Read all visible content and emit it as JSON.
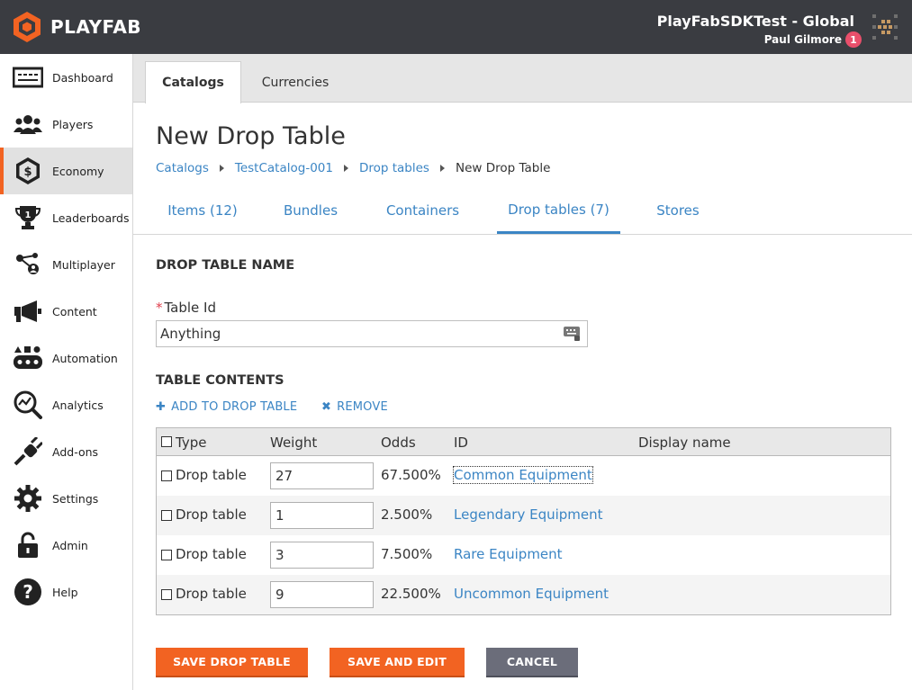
{
  "app": {
    "brand": "PLAYFAB",
    "title": "PlayFabSDKTest - Global",
    "user": "Paul Gilmore",
    "notification_count": "1"
  },
  "sidebar": {
    "items": [
      {
        "label": "Dashboard",
        "icon": "dashboard-icon"
      },
      {
        "label": "Players",
        "icon": "players-icon"
      },
      {
        "label": "Economy",
        "icon": "economy-icon",
        "active": true
      },
      {
        "label": "Leaderboards",
        "icon": "leaderboards-icon"
      },
      {
        "label": "Multiplayer",
        "icon": "multiplayer-icon"
      },
      {
        "label": "Content",
        "icon": "megaphone-icon"
      },
      {
        "label": "Automation",
        "icon": "automation-icon"
      },
      {
        "label": "Analytics",
        "icon": "analytics-icon"
      },
      {
        "label": "Add-ons",
        "icon": "plug-icon"
      },
      {
        "label": "Settings",
        "icon": "gear-icon"
      },
      {
        "label": "Admin",
        "icon": "lock-icon"
      },
      {
        "label": "Help",
        "icon": "help-icon"
      }
    ]
  },
  "main_tabs": [
    {
      "label": "Catalogs",
      "active": true
    },
    {
      "label": "Currencies",
      "active": false
    }
  ],
  "page": {
    "title": "New Drop Table",
    "breadcrumb": [
      "Catalogs",
      "TestCatalog-001",
      "Drop tables",
      "New Drop Table"
    ]
  },
  "sub_tabs": [
    {
      "label": "Items (12)"
    },
    {
      "label": "Bundles"
    },
    {
      "label": "Containers"
    },
    {
      "label": "Drop tables (7)",
      "active": true
    },
    {
      "label": "Stores"
    }
  ],
  "form": {
    "name_section": "DROP TABLE NAME",
    "table_id_required": "*",
    "table_id_label": "Table Id",
    "table_id_value": "Anything",
    "contents_section": "TABLE CONTENTS",
    "add_label": "ADD TO DROP TABLE",
    "remove_label": "REMOVE"
  },
  "table": {
    "columns": [
      "Type",
      "Weight",
      "Odds",
      "ID",
      "Display name"
    ],
    "rows": [
      {
        "type": "Drop table",
        "weight": "27",
        "odds": "67.500%",
        "id": "Common Equipment",
        "display_name": ""
      },
      {
        "type": "Drop table",
        "weight": "1",
        "odds": "2.500%",
        "id": "Legendary Equipment",
        "display_name": ""
      },
      {
        "type": "Drop table",
        "weight": "3",
        "odds": "7.500%",
        "id": "Rare Equipment",
        "display_name": ""
      },
      {
        "type": "Drop table",
        "weight": "9",
        "odds": "22.500%",
        "id": "Uncommon Equipment",
        "display_name": ""
      }
    ]
  },
  "buttons": {
    "save": "SAVE DROP TABLE",
    "save_edit": "SAVE AND EDIT",
    "cancel": "CANCEL"
  },
  "colors": {
    "accent_orange": "#f26322",
    "link_blue": "#3b85c4",
    "header_bg": "#3a3c41",
    "cancel_gray": "#6b6d7a"
  }
}
